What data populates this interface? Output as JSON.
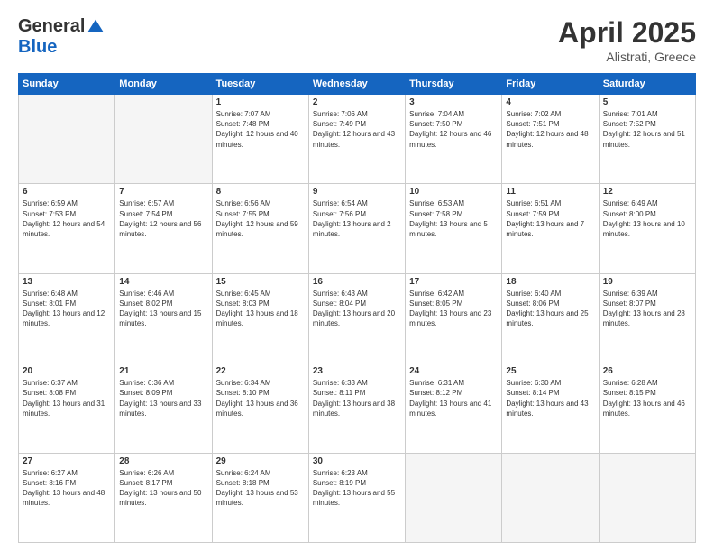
{
  "header": {
    "logo_general": "General",
    "logo_blue": "Blue",
    "title": "April 2025",
    "location": "Alistrati, Greece"
  },
  "weekdays": [
    "Sunday",
    "Monday",
    "Tuesday",
    "Wednesday",
    "Thursday",
    "Friday",
    "Saturday"
  ],
  "weeks": [
    [
      {
        "day": "",
        "empty": true
      },
      {
        "day": "",
        "empty": true
      },
      {
        "day": "1",
        "sunrise": "7:07 AM",
        "sunset": "7:48 PM",
        "daylight": "12 hours and 40 minutes."
      },
      {
        "day": "2",
        "sunrise": "7:06 AM",
        "sunset": "7:49 PM",
        "daylight": "12 hours and 43 minutes."
      },
      {
        "day": "3",
        "sunrise": "7:04 AM",
        "sunset": "7:50 PM",
        "daylight": "12 hours and 46 minutes."
      },
      {
        "day": "4",
        "sunrise": "7:02 AM",
        "sunset": "7:51 PM",
        "daylight": "12 hours and 48 minutes."
      },
      {
        "day": "5",
        "sunrise": "7:01 AM",
        "sunset": "7:52 PM",
        "daylight": "12 hours and 51 minutes."
      }
    ],
    [
      {
        "day": "6",
        "sunrise": "6:59 AM",
        "sunset": "7:53 PM",
        "daylight": "12 hours and 54 minutes."
      },
      {
        "day": "7",
        "sunrise": "6:57 AM",
        "sunset": "7:54 PM",
        "daylight": "12 hours and 56 minutes."
      },
      {
        "day": "8",
        "sunrise": "6:56 AM",
        "sunset": "7:55 PM",
        "daylight": "12 hours and 59 minutes."
      },
      {
        "day": "9",
        "sunrise": "6:54 AM",
        "sunset": "7:56 PM",
        "daylight": "13 hours and 2 minutes."
      },
      {
        "day": "10",
        "sunrise": "6:53 AM",
        "sunset": "7:58 PM",
        "daylight": "13 hours and 5 minutes."
      },
      {
        "day": "11",
        "sunrise": "6:51 AM",
        "sunset": "7:59 PM",
        "daylight": "13 hours and 7 minutes."
      },
      {
        "day": "12",
        "sunrise": "6:49 AM",
        "sunset": "8:00 PM",
        "daylight": "13 hours and 10 minutes."
      }
    ],
    [
      {
        "day": "13",
        "sunrise": "6:48 AM",
        "sunset": "8:01 PM",
        "daylight": "13 hours and 12 minutes."
      },
      {
        "day": "14",
        "sunrise": "6:46 AM",
        "sunset": "8:02 PM",
        "daylight": "13 hours and 15 minutes."
      },
      {
        "day": "15",
        "sunrise": "6:45 AM",
        "sunset": "8:03 PM",
        "daylight": "13 hours and 18 minutes."
      },
      {
        "day": "16",
        "sunrise": "6:43 AM",
        "sunset": "8:04 PM",
        "daylight": "13 hours and 20 minutes."
      },
      {
        "day": "17",
        "sunrise": "6:42 AM",
        "sunset": "8:05 PM",
        "daylight": "13 hours and 23 minutes."
      },
      {
        "day": "18",
        "sunrise": "6:40 AM",
        "sunset": "8:06 PM",
        "daylight": "13 hours and 25 minutes."
      },
      {
        "day": "19",
        "sunrise": "6:39 AM",
        "sunset": "8:07 PM",
        "daylight": "13 hours and 28 minutes."
      }
    ],
    [
      {
        "day": "20",
        "sunrise": "6:37 AM",
        "sunset": "8:08 PM",
        "daylight": "13 hours and 31 minutes."
      },
      {
        "day": "21",
        "sunrise": "6:36 AM",
        "sunset": "8:09 PM",
        "daylight": "13 hours and 33 minutes."
      },
      {
        "day": "22",
        "sunrise": "6:34 AM",
        "sunset": "8:10 PM",
        "daylight": "13 hours and 36 minutes."
      },
      {
        "day": "23",
        "sunrise": "6:33 AM",
        "sunset": "8:11 PM",
        "daylight": "13 hours and 38 minutes."
      },
      {
        "day": "24",
        "sunrise": "6:31 AM",
        "sunset": "8:12 PM",
        "daylight": "13 hours and 41 minutes."
      },
      {
        "day": "25",
        "sunrise": "6:30 AM",
        "sunset": "8:14 PM",
        "daylight": "13 hours and 43 minutes."
      },
      {
        "day": "26",
        "sunrise": "6:28 AM",
        "sunset": "8:15 PM",
        "daylight": "13 hours and 46 minutes."
      }
    ],
    [
      {
        "day": "27",
        "sunrise": "6:27 AM",
        "sunset": "8:16 PM",
        "daylight": "13 hours and 48 minutes."
      },
      {
        "day": "28",
        "sunrise": "6:26 AM",
        "sunset": "8:17 PM",
        "daylight": "13 hours and 50 minutes."
      },
      {
        "day": "29",
        "sunrise": "6:24 AM",
        "sunset": "8:18 PM",
        "daylight": "13 hours and 53 minutes."
      },
      {
        "day": "30",
        "sunrise": "6:23 AM",
        "sunset": "8:19 PM",
        "daylight": "13 hours and 55 minutes."
      },
      {
        "day": "",
        "empty": true
      },
      {
        "day": "",
        "empty": true
      },
      {
        "day": "",
        "empty": true
      }
    ]
  ]
}
